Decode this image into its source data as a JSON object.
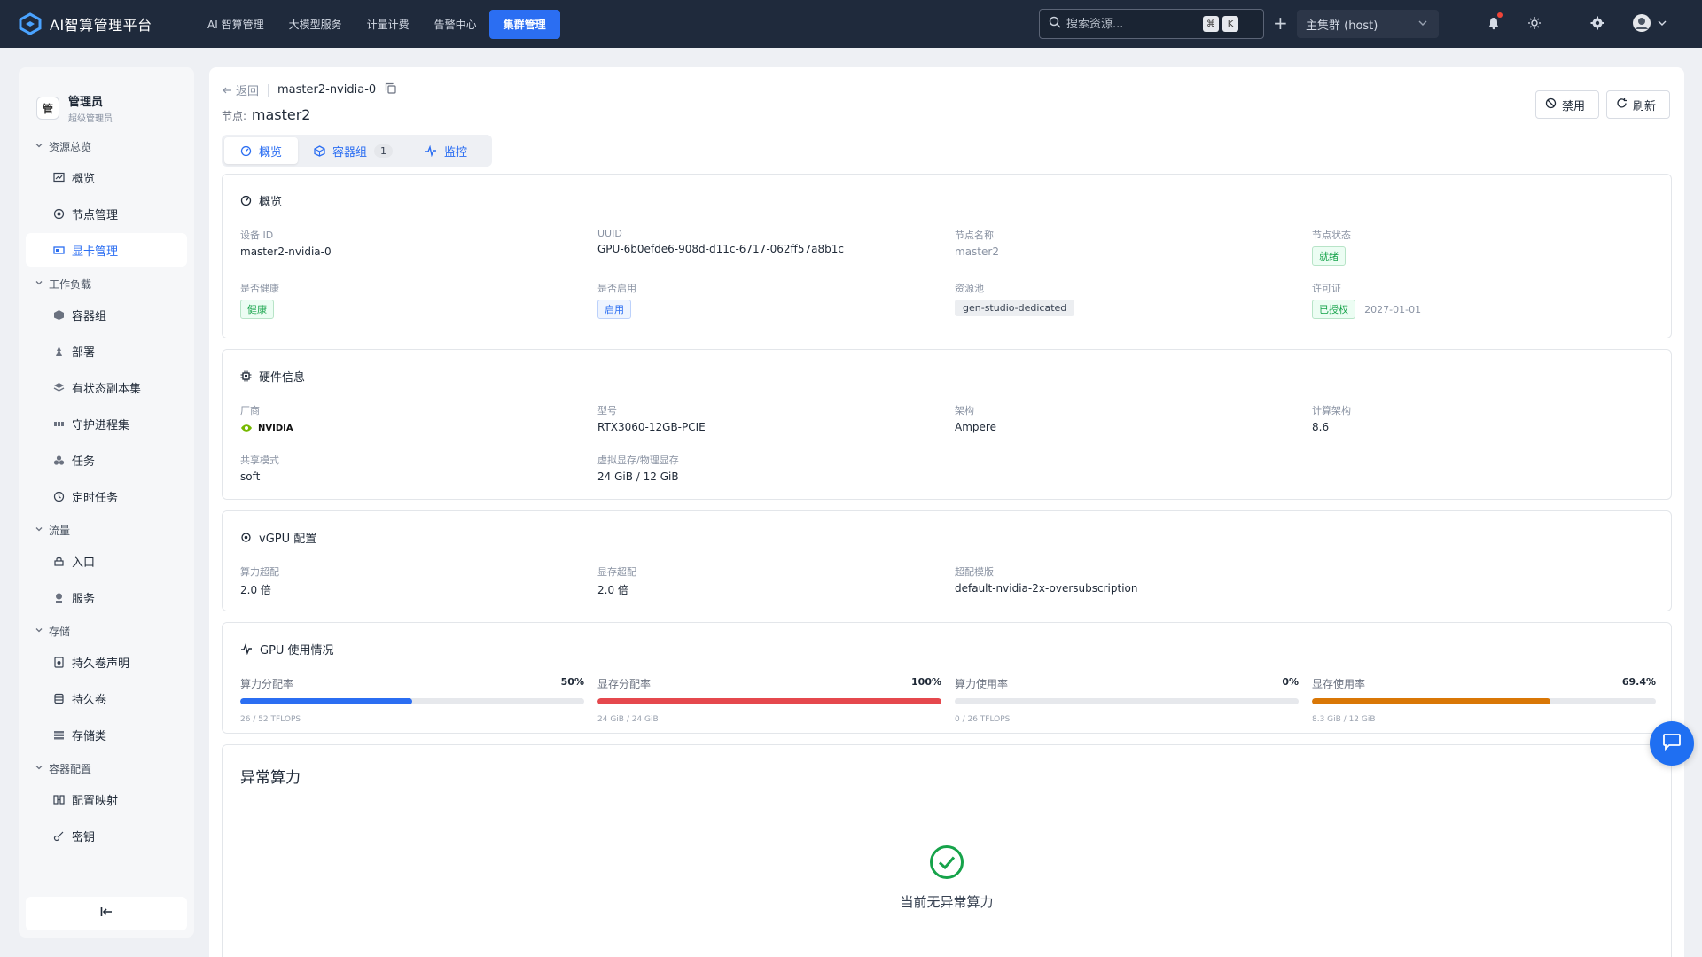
{
  "app": {
    "title": "AI智算管理平台"
  },
  "topnav": [
    {
      "label": "AI 智算管理",
      "active": false
    },
    {
      "label": "大模型服务",
      "active": false
    },
    {
      "label": "计量计费",
      "active": false
    },
    {
      "label": "告警中心",
      "active": false
    },
    {
      "label": "集群管理",
      "active": true
    }
  ],
  "search": {
    "placeholder": "搜索资源...",
    "shortcut_mod": "⌘",
    "shortcut_key": "K"
  },
  "cluster": {
    "selected": "主集群 (host)"
  },
  "user": {
    "name": "管理员",
    "role": "超级管理员",
    "avatar_text": "管"
  },
  "sidebar": {
    "groups": [
      {
        "title": "资源总览",
        "items": [
          {
            "label": "概览",
            "icon": "chart-icon",
            "active": false
          },
          {
            "label": "节点管理",
            "icon": "node-icon",
            "active": false
          },
          {
            "label": "显卡管理",
            "icon": "gpu-icon",
            "active": true
          }
        ]
      },
      {
        "title": "工作负载",
        "items": [
          {
            "label": "容器组",
            "icon": "cube-icon",
            "active": false
          },
          {
            "label": "部署",
            "icon": "deploy-icon",
            "active": false
          },
          {
            "label": "有状态副本集",
            "icon": "layers-icon",
            "active": false
          },
          {
            "label": "守护进程集",
            "icon": "daemon-icon",
            "active": false
          },
          {
            "label": "任务",
            "icon": "job-icon",
            "active": false
          },
          {
            "label": "定时任务",
            "icon": "clock-icon",
            "active": false
          }
        ]
      },
      {
        "title": "流量",
        "items": [
          {
            "label": "入口",
            "icon": "ingress-icon",
            "active": false
          },
          {
            "label": "服务",
            "icon": "service-icon",
            "active": false
          }
        ]
      },
      {
        "title": "存储",
        "items": [
          {
            "label": "持久卷声明",
            "icon": "pvc-icon",
            "active": false
          },
          {
            "label": "持久卷",
            "icon": "pv-icon",
            "active": false
          },
          {
            "label": "存储类",
            "icon": "storageclass-icon",
            "active": false
          }
        ]
      },
      {
        "title": "容器配置",
        "items": [
          {
            "label": "配置映射",
            "icon": "configmap-icon",
            "active": false
          },
          {
            "label": "密钥",
            "icon": "key-icon",
            "active": false
          }
        ]
      }
    ]
  },
  "header": {
    "back": "返回",
    "device_name": "master2-nvidia-0",
    "node_label": "节点:",
    "node_value": "master2",
    "disable_btn": "禁用",
    "refresh_btn": "刷新"
  },
  "tabs": [
    {
      "label": "概览",
      "active": true
    },
    {
      "label": "容器组",
      "badge": "1",
      "active": false
    },
    {
      "label": "监控",
      "active": false
    }
  ],
  "overview": {
    "title": "概览",
    "device_id": {
      "label": "设备 ID",
      "value": "master2-nvidia-0"
    },
    "uuid": {
      "label": "UUID",
      "value": "GPU-6b0efde6-908d-d11c-6717-062ff57a8b1c"
    },
    "node_name": {
      "label": "节点名称",
      "value": "master2"
    },
    "node_status": {
      "label": "节点状态",
      "value": "就绪"
    },
    "healthy": {
      "label": "是否健康",
      "value": "健康"
    },
    "enabled": {
      "label": "是否启用",
      "value": "启用"
    },
    "pool": {
      "label": "资源池",
      "value": "gen-studio-dedicated"
    },
    "license": {
      "label": "许可证",
      "value": "已授权",
      "date": "2027-01-01"
    }
  },
  "hardware": {
    "title": "硬件信息",
    "vendor": {
      "label": "厂商",
      "value": "NVIDIA"
    },
    "model": {
      "label": "型号",
      "value": "RTX3060-12GB-PCIE"
    },
    "arch": {
      "label": "架构",
      "value": "Ampere"
    },
    "compute_arch": {
      "label": "计算架构",
      "value": "8.6"
    },
    "share_mode": {
      "label": "共享模式",
      "value": "soft"
    },
    "memory": {
      "label": "虚拟显存/物理显存",
      "value": "24 GiB / 12 GiB"
    }
  },
  "vgpu": {
    "title": "vGPU 配置",
    "compute_over": {
      "label": "算力超配",
      "value": "2.0 倍"
    },
    "memory_over": {
      "label": "显存超配",
      "value": "2.0 倍"
    },
    "template": {
      "label": "超配模版",
      "value": "default-nvidia-2x-oversubscription"
    }
  },
  "usage": {
    "title": "GPU 使用情况",
    "items": [
      {
        "label": "算力分配率",
        "percent_text": "50%",
        "fraction": 0.5,
        "color": "#2b6ef2",
        "sub": "26 / 52 TFLOPS"
      },
      {
        "label": "显存分配率",
        "percent_text": "100%",
        "fraction": 1.0,
        "color": "#e5484d",
        "sub": "24 GiB / 24 GiB"
      },
      {
        "label": "算力使用率",
        "percent_text": "0%",
        "fraction": 0.0,
        "color": "#2b6ef2",
        "sub": "0 / 26 TFLOPS"
      },
      {
        "label": "显存使用率",
        "percent_text": "69.4%",
        "fraction": 0.694,
        "color": "#d97706",
        "sub": "8.3 GiB / 12 GiB"
      }
    ]
  },
  "anomaly": {
    "title": "异常算力",
    "empty_text": "当前无异常算力"
  },
  "colors": {
    "accent": "#2b6ef2",
    "topbar": "#1f2a3c",
    "success": "#16a34a"
  }
}
